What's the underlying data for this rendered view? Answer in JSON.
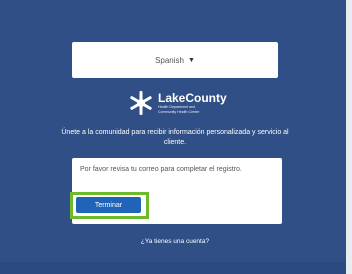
{
  "language_selector": {
    "value": "Spanish",
    "icon": "caret-down-icon"
  },
  "logo": {
    "name": "LakeCounty",
    "subtitle_line1": "Health Department and",
    "subtitle_line2": "Community Health Center",
    "icon": "snowflake-star-icon"
  },
  "tagline": "Únete a la comunidad para recibir información personalizada y servicio al cliente.",
  "card": {
    "message": "Por favor revisa tu correo para completar el registro.",
    "button_label": "Terminar"
  },
  "footer_link": "¿Ya tienes una cuenta?",
  "colors": {
    "background": "#2f4f86",
    "button": "#1f64b6",
    "highlight": "#6dba2c"
  }
}
